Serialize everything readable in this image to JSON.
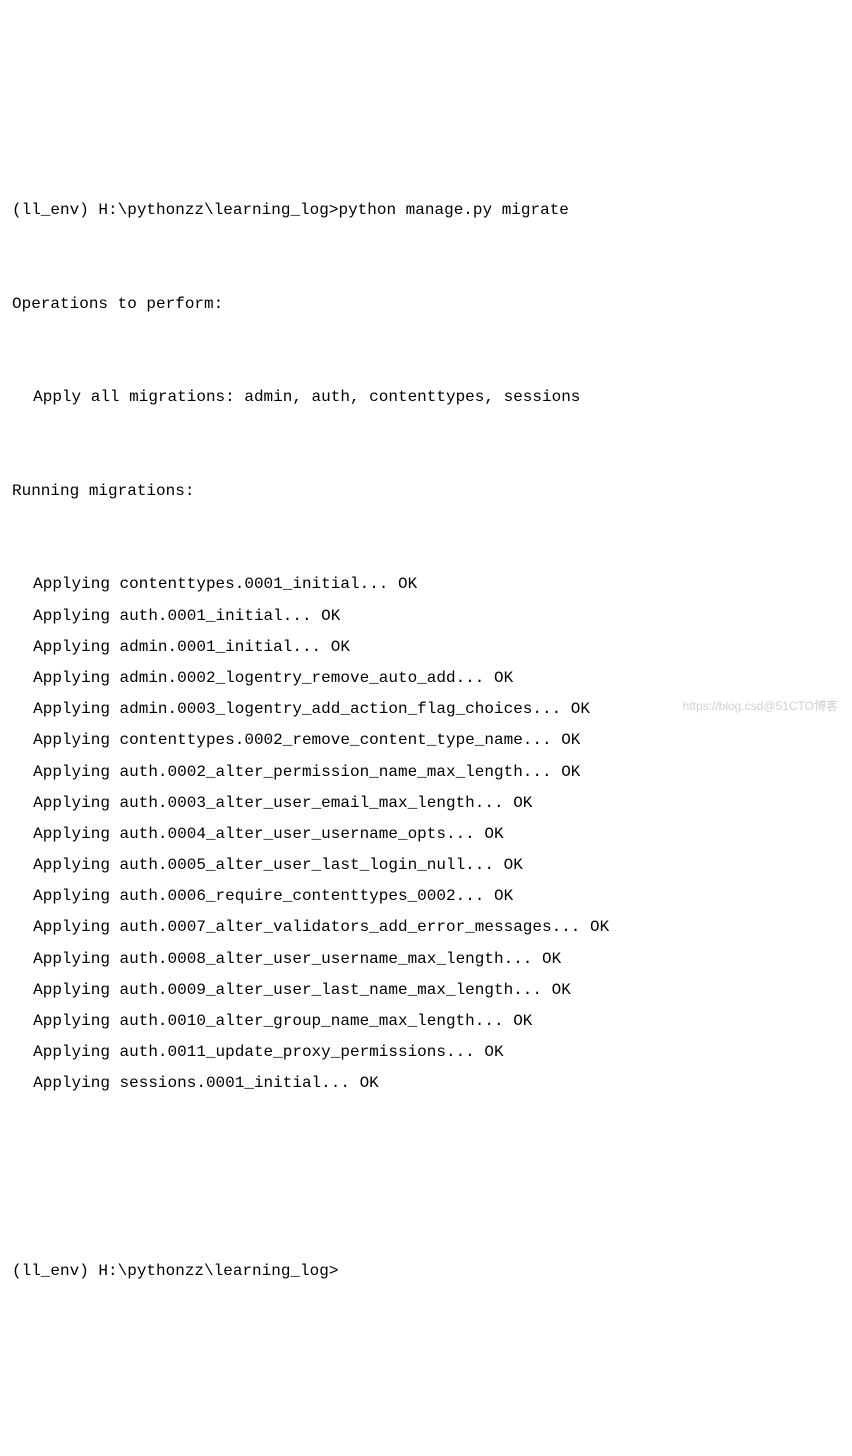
{
  "terminal": {
    "prompt_env": "(ll_env)",
    "prompt_path": "H:\\pythonzz\\learning_log>",
    "command": "python manage.py migrate",
    "operations_header": "Operations to perform:",
    "apply_all_line": "Apply all migrations: admin, auth, contenttypes, sessions",
    "running_header": "Running migrations:",
    "migrations": [
      "Applying contenttypes.0001_initial... OK",
      "Applying auth.0001_initial... OK",
      "Applying admin.0001_initial... OK",
      "Applying admin.0002_logentry_remove_auto_add... OK",
      "Applying admin.0003_logentry_add_action_flag_choices... OK",
      "Applying contenttypes.0002_remove_content_type_name... OK",
      "Applying auth.0002_alter_permission_name_max_length... OK",
      "Applying auth.0003_alter_user_email_max_length... OK",
      "Applying auth.0004_alter_user_username_opts... OK",
      "Applying auth.0005_alter_user_last_login_null... OK",
      "Applying auth.0006_require_contenttypes_0002... OK",
      "Applying auth.0007_alter_validators_add_error_messages... OK",
      "Applying auth.0008_alter_user_username_max_length... OK",
      "Applying auth.0009_alter_user_last_name_max_length... OK",
      "Applying auth.0010_alter_group_name_max_length... OK",
      "Applying auth.0011_update_proxy_permissions... OK",
      "Applying sessions.0001_initial... OK"
    ],
    "final_prompt": "(ll_env) H:\\pythonzz\\learning_log>"
  },
  "watermark": "https://blog.csd@51CTO博客"
}
